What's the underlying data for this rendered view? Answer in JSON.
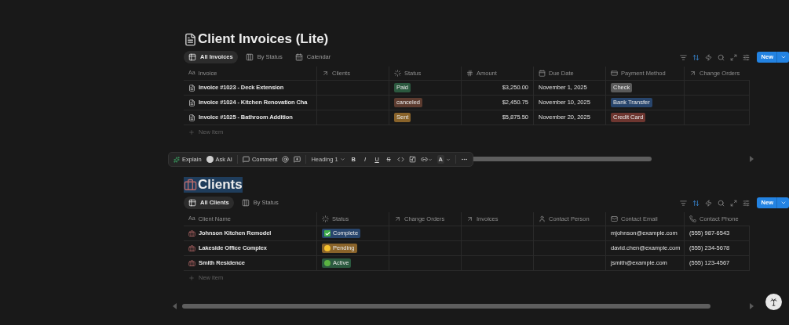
{
  "sections": [
    {
      "kind": "invoices",
      "title": "Client Invoices (Lite)",
      "title_selected": false,
      "tabs": [
        {
          "label": "All Invoices",
          "kind": "table",
          "selected": true
        },
        {
          "label": "By Status",
          "kind": "board",
          "selected": false
        },
        {
          "label": "Calendar",
          "kind": "calendar",
          "selected": false
        }
      ],
      "new_button": "New",
      "columns": [
        {
          "label": "Invoice",
          "kind": "title",
          "glyph": "Aa"
        },
        {
          "label": "Clients",
          "kind": "relation"
        },
        {
          "label": "Status",
          "kind": "status"
        },
        {
          "label": "Amount",
          "kind": "number"
        },
        {
          "label": "Due Date",
          "kind": "date"
        },
        {
          "label": "Payment Method",
          "kind": "select"
        },
        {
          "label": "Change Orders",
          "kind": "relation"
        }
      ],
      "rows": [
        {
          "cells": [
            {
              "kind": "title",
              "text": "Invoice #1023 - Deck Extension"
            },
            {
              "kind": "empty"
            },
            {
              "kind": "tag",
              "text": "Paid",
              "color": "#2b593f"
            },
            {
              "kind": "number",
              "text": "$3,250.00"
            },
            {
              "kind": "text",
              "text": "November 1, 2025"
            },
            {
              "kind": "tag",
              "text": "Check",
              "color": "#5a5a5a"
            },
            {
              "kind": "empty"
            }
          ]
        },
        {
          "cells": [
            {
              "kind": "title",
              "text": "Invoice #1024 - Kitchen Renovation Cha"
            },
            {
              "kind": "empty"
            },
            {
              "kind": "tag",
              "text": "canceled",
              "color": "#5c3b2f"
            },
            {
              "kind": "number",
              "text": "$2,450.75"
            },
            {
              "kind": "text",
              "text": "November 10, 2025"
            },
            {
              "kind": "tag",
              "text": "Bank Transfer",
              "color": "#28456c"
            },
            {
              "kind": "empty"
            }
          ]
        },
        {
          "cells": [
            {
              "kind": "title",
              "text": "Invoice #1025 - Bathroom Addition"
            },
            {
              "kind": "empty"
            },
            {
              "kind": "tag",
              "text": "Sent",
              "color": "#89632a"
            },
            {
              "kind": "number",
              "text": "$5,875.50"
            },
            {
              "kind": "text",
              "text": "November 20, 2025"
            },
            {
              "kind": "tag",
              "text": "Credit Card",
              "color": "#6e3630"
            },
            {
              "kind": "empty"
            }
          ]
        }
      ],
      "new_item": "New item",
      "scroll_left_arrow": false
    },
    {
      "kind": "clients",
      "title": "Clients",
      "title_selected": true,
      "tabs": [
        {
          "label": "All Clients",
          "kind": "table",
          "selected": true
        },
        {
          "label": "By Status",
          "kind": "board",
          "selected": false
        }
      ],
      "new_button": "New",
      "columns": [
        {
          "label": "Client Name",
          "kind": "title",
          "glyph": "Aa"
        },
        {
          "label": "Status",
          "kind": "status"
        },
        {
          "label": "Change Orders",
          "kind": "relation"
        },
        {
          "label": "Invoices",
          "kind": "relation"
        },
        {
          "label": "Contact Person",
          "kind": "person"
        },
        {
          "label": "Contact Email",
          "kind": "email"
        },
        {
          "label": "Contact Phone",
          "kind": "phone"
        }
      ],
      "rows": [
        {
          "cells": [
            {
              "kind": "title",
              "text": "Johnson Kitchen Remodel"
            },
            {
              "kind": "tag-check",
              "text": "Complete",
              "color": "#28456c"
            },
            {
              "kind": "empty"
            },
            {
              "kind": "empty"
            },
            {
              "kind": "empty"
            },
            {
              "kind": "text",
              "text": "mjohnson@example.com"
            },
            {
              "kind": "text",
              "text": "(555) 987-6543"
            }
          ]
        },
        {
          "cells": [
            {
              "kind": "title",
              "text": "Lakeside Office Complex"
            },
            {
              "kind": "tag-yellow-dot",
              "text": "Pending",
              "color": "#89632a"
            },
            {
              "kind": "empty"
            },
            {
              "kind": "empty"
            },
            {
              "kind": "empty"
            },
            {
              "kind": "text",
              "text": "david.chen@example.com"
            },
            {
              "kind": "text",
              "text": "(555) 234-5678"
            }
          ]
        },
        {
          "cells": [
            {
              "kind": "title",
              "text": "Smith Residence"
            },
            {
              "kind": "tag-green-dot",
              "text": "Active",
              "color": "#2b593f"
            },
            {
              "kind": "empty"
            },
            {
              "kind": "empty"
            },
            {
              "kind": "empty"
            },
            {
              "kind": "text",
              "text": "jsmith@example.com"
            },
            {
              "kind": "text",
              "text": "(555) 123-4567"
            }
          ]
        }
      ],
      "new_item": "New item",
      "scroll_left_arrow": true
    }
  ],
  "format_toolbar": {
    "explain": "Explain",
    "ask_ai": "Ask AI",
    "comment": "Comment",
    "block_type": "Heading 1",
    "marks": [
      {
        "kind": "bold",
        "text": "B"
      },
      {
        "kind": "italic",
        "text": "I"
      },
      {
        "kind": "underline",
        "text": "U"
      },
      {
        "kind": "strike",
        "text": "S"
      }
    ],
    "color_button": "A"
  }
}
